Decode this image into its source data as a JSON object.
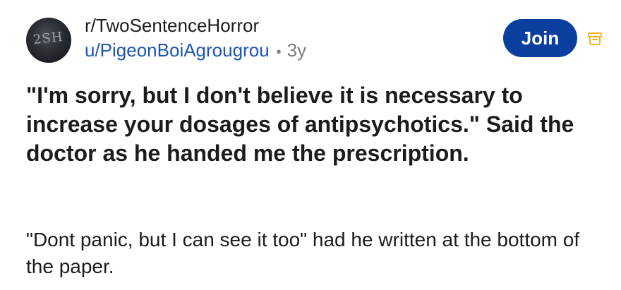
{
  "post": {
    "subreddit": "r/TwoSentenceHorror",
    "avatar_text": "2SH",
    "author": "u/PigeonBoiAgrougrou",
    "separator": "•",
    "age": "3y",
    "join_label": "Join",
    "archive_icon": "archive-icon",
    "title": "\"I'm sorry, but I don't believe it is necessary to increase your dosages of antipsychotics.\" Said the doctor as he handed me the prescription.",
    "body": "\"Dont panic, but I can see it too\" had he written at the bottom of the paper."
  },
  "colors": {
    "join_button": "#0a3fa0",
    "username": "#1c55b5",
    "archive_icon": "#f2b320"
  }
}
